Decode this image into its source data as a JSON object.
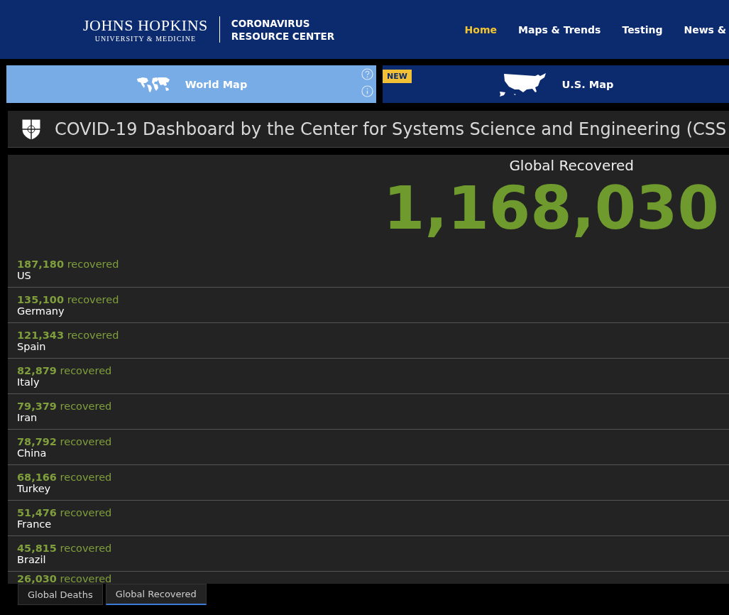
{
  "header": {
    "logo_title": "JOHNS HOPKINS",
    "logo_subtitle": "UNIVERSITY & MEDICINE",
    "site_name": [
      "CORONAVIRUS",
      "RESOURCE CENTER"
    ],
    "nav": [
      {
        "label": "Home",
        "selected": true
      },
      {
        "label": "Maps & Trends",
        "selected": false
      },
      {
        "label": "Testing",
        "selected": false
      },
      {
        "label": "News &",
        "selected": false
      }
    ]
  },
  "map_tabs": [
    {
      "label": "World Map",
      "selected": true,
      "kind": "world"
    },
    {
      "label": "U.S. Map",
      "selected": false,
      "kind": "us",
      "badge": "NEW"
    }
  ],
  "dashboard_title": "COVID-19 Dashboard by the Center for Systems Science and Engineering (CSS",
  "panel": {
    "title": "Global Recovered",
    "total": "1,168,030",
    "rows": [
      {
        "count": "187,180",
        "unit": "recovered",
        "country": "US"
      },
      {
        "count": "135,100",
        "unit": "recovered",
        "country": "Germany"
      },
      {
        "count": "121,343",
        "unit": "recovered",
        "country": "Spain"
      },
      {
        "count": "82,879",
        "unit": "recovered",
        "country": "Italy"
      },
      {
        "count": "79,379",
        "unit": "recovered",
        "country": "Iran"
      },
      {
        "count": "78,792",
        "unit": "recovered",
        "country": "China"
      },
      {
        "count": "68,166",
        "unit": "recovered",
        "country": "Turkey"
      },
      {
        "count": "51,476",
        "unit": "recovered",
        "country": "France"
      },
      {
        "count": "45,815",
        "unit": "recovered",
        "country": "Brazil"
      },
      {
        "count": "26,030",
        "unit": "recovered"
      }
    ]
  },
  "bottom_tabs": [
    {
      "label": "Global Deaths",
      "selected": false
    },
    {
      "label": "Global Recovered",
      "selected": true
    }
  ]
}
